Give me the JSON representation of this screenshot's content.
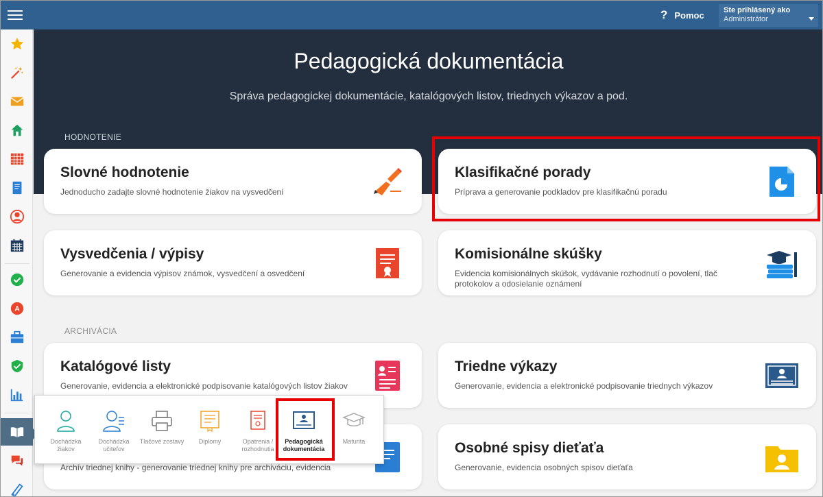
{
  "header": {
    "menu_icon": "hamburger-icon",
    "help_label": "Pomoc",
    "user_label": "Ste prihlásený ako",
    "user_name": "Administrátor"
  },
  "sidebar": {
    "items": [
      {
        "icon": "star-icon",
        "color": "#f5b400"
      },
      {
        "icon": "magic-wand-icon",
        "color": "#e8452c"
      },
      {
        "icon": "envelope-icon",
        "color": "#f0a020"
      },
      {
        "icon": "home-icon",
        "color": "#1e9e60"
      },
      {
        "icon": "calendar-grid-icon",
        "color": "#e8452c"
      },
      {
        "icon": "book-icon",
        "color": "#2a7fd4"
      },
      {
        "icon": "user-circle-icon",
        "color": "#e8452c"
      },
      {
        "icon": "calendar-icon",
        "color": "#1f3a5a"
      },
      {
        "icon": "check-badge-icon",
        "color": "#22b04a"
      },
      {
        "icon": "grade-badge-icon",
        "color": "#e8452c"
      },
      {
        "icon": "briefcase-icon",
        "color": "#2a7fd4"
      },
      {
        "icon": "shield-check-icon",
        "color": "#22b04a"
      },
      {
        "icon": "bar-chart-icon",
        "color": "#2a7fd4"
      },
      {
        "icon": "open-book-icon",
        "color": "#ffffff"
      },
      {
        "icon": "chat-icon",
        "color": "#e8452c"
      },
      {
        "icon": "pen-icon",
        "color": "#2a7fd4"
      }
    ]
  },
  "hero": {
    "title": "Pedagogická dokumentácia",
    "subtitle": "Správa pedagogickej dokumentácie, katalógových listov, triednych výkazov a pod."
  },
  "sections": {
    "evaluation": "HODNOTENIE",
    "archive": "ARCHIVÁCIA"
  },
  "cards": [
    {
      "title": "Slovné hodnotenie",
      "desc": "Jednoducho zadajte slovné hodnotenie žiakov na vysvedčení",
      "icon": "writing-hand-icon"
    },
    {
      "title": "Klasifikačné porady",
      "desc": "Príprava a generovanie podkladov pre klasifikačnú poradu",
      "icon": "pie-document-icon"
    },
    {
      "title": "Vysvedčenia / výpisy",
      "desc": "Generovanie a evidencia výpisov známok, vysvedčení a osvedčení",
      "icon": "certificate-icon"
    },
    {
      "title": "Komisionálne skúšky",
      "desc": "Evidencia komisionálnych skúšok, vydávanie rozhodnutí o povolení, tlač protokolov a odosielanie oznámení",
      "icon": "graduation-books-icon"
    },
    {
      "title": "Katalógové listy",
      "desc": "Generovanie, evidencia a elektronické podpisovanie katalógových listov žiakov",
      "icon": "student-card-icon"
    },
    {
      "title": "Triedne výkazy",
      "desc": "Generovanie, evidencia a elektronické podpisovanie triednych výkazov",
      "icon": "classroom-board-icon"
    },
    {
      "title": "",
      "desc": "Archív triednej knihy - generovanie triednej knihy pre archiváciu, evidencia",
      "icon": "document-icon"
    },
    {
      "title": "Osobné spisy dieťaťa",
      "desc": "Generovanie, evidencia osobných spisov dieťaťa",
      "icon": "person-folder-icon"
    }
  ],
  "popup": {
    "items": [
      {
        "label": "Dochádzka žiakov",
        "icon": "student-attendance-icon"
      },
      {
        "label": "Dochádzka učiteľov",
        "icon": "teacher-attendance-icon"
      },
      {
        "label": "Tlačové zostavy",
        "icon": "printer-icon"
      },
      {
        "label": "Diplomy",
        "icon": "diploma-icon"
      },
      {
        "label": "Opatrenia / rozhodnutia",
        "icon": "decision-document-icon"
      },
      {
        "label": "Pedagogická dokumentácia",
        "icon": "pedagogical-docs-icon"
      },
      {
        "label": "Maturita",
        "icon": "graduation-cap-icon"
      }
    ]
  }
}
